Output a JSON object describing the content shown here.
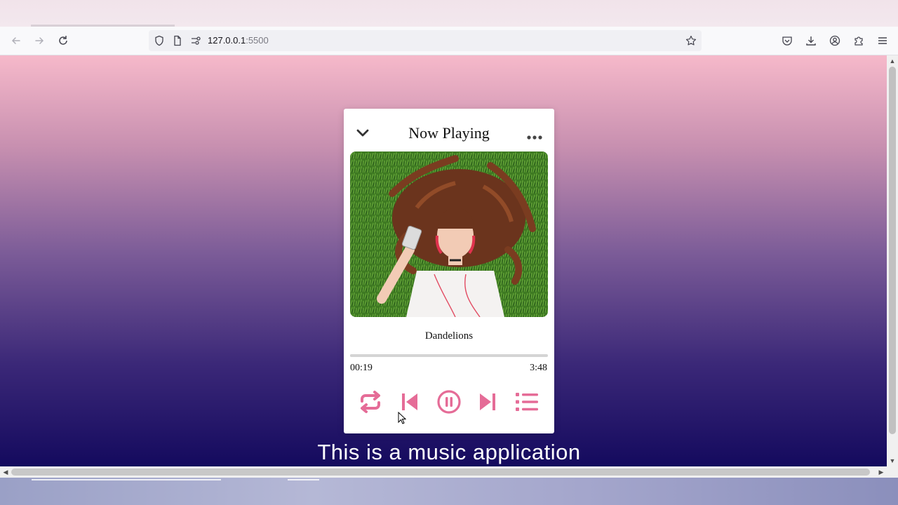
{
  "browser": {
    "url_host": "127.0.0.1",
    "url_port": ":5500",
    "icons": {
      "back": "arrow-left-icon",
      "forward": "arrow-right-icon",
      "reload": "reload-icon",
      "shield": "shield-icon",
      "page": "page-icon",
      "permissions": "permissions-icon",
      "bookmark": "star-icon",
      "pocket": "pocket-icon",
      "downloads": "download-icon",
      "account": "account-icon",
      "extensions": "puzzle-icon",
      "menu": "hamburger-menu-icon"
    }
  },
  "player": {
    "title": "Now Playing",
    "song_name": "Dandelions",
    "current_time": "00:19",
    "duration": "3:48",
    "progress_fraction": 0.083,
    "accent_color": "#e56c97",
    "icons": {
      "collapse": "chevron-down-icon",
      "more": "more-dots-icon",
      "repeat": "repeat-icon",
      "previous": "skip-previous-icon",
      "pause": "pause-circle-icon",
      "next": "skip-next-icon",
      "playlist": "playlist-icon"
    }
  },
  "caption": "This is a music application"
}
